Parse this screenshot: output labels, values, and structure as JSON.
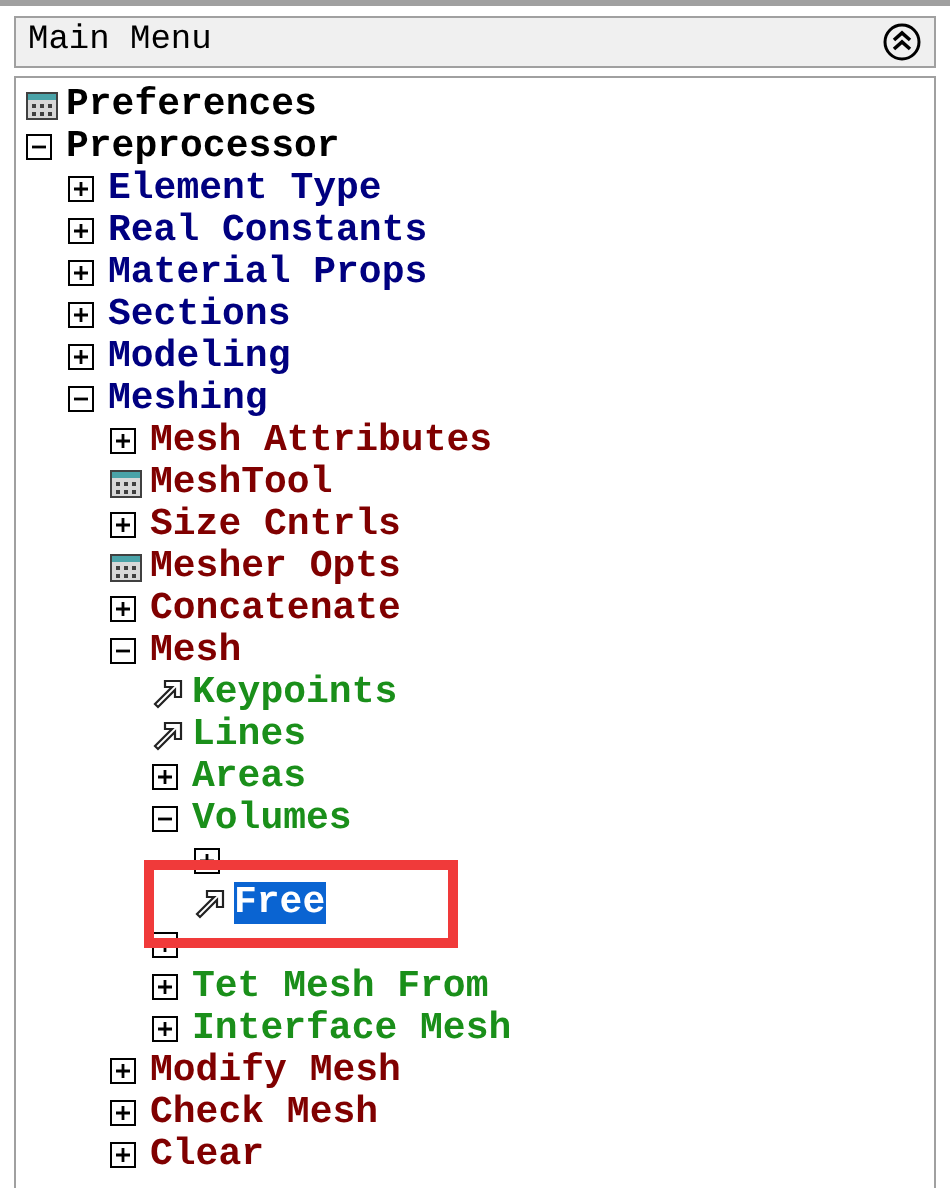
{
  "panel": {
    "title": "Main Menu"
  },
  "tree": [
    {
      "label": "Preferences",
      "kind": "dialog",
      "selected": false
    },
    {
      "label": "Preprocessor",
      "kind": "folder",
      "expanded": true,
      "selected": false,
      "children": [
        {
          "label": "Element Type",
          "kind": "folder",
          "expanded": false,
          "selected": false
        },
        {
          "label": "Real Constants",
          "kind": "folder",
          "expanded": false,
          "selected": false
        },
        {
          "label": "Material Props",
          "kind": "folder",
          "expanded": false,
          "selected": false
        },
        {
          "label": "Sections",
          "kind": "folder",
          "expanded": false,
          "selected": false
        },
        {
          "label": "Modeling",
          "kind": "folder",
          "expanded": false,
          "selected": false
        },
        {
          "label": "Meshing",
          "kind": "folder",
          "expanded": true,
          "selected": false,
          "children": [
            {
              "label": "Mesh Attributes",
              "kind": "folder",
              "expanded": false,
              "selected": false
            },
            {
              "label": "MeshTool",
              "kind": "dialog",
              "selected": false
            },
            {
              "label": "Size Cntrls",
              "kind": "folder",
              "expanded": false,
              "selected": false
            },
            {
              "label": "Mesher Opts",
              "kind": "dialog",
              "selected": false
            },
            {
              "label": "Concatenate",
              "kind": "folder",
              "expanded": false,
              "selected": false
            },
            {
              "label": "Mesh",
              "kind": "folder",
              "expanded": true,
              "selected": false,
              "children": [
                {
                  "label": "Keypoints",
                  "kind": "command",
                  "selected": false
                },
                {
                  "label": "Lines",
                  "kind": "command",
                  "selected": false
                },
                {
                  "label": "Areas",
                  "kind": "folder",
                  "expanded": false,
                  "selected": false
                },
                {
                  "label": "Volumes",
                  "kind": "folder",
                  "expanded": true,
                  "selected": false,
                  "children": [
                    {
                      "kind": "folder",
                      "expanded": false,
                      "selected": false,
                      "highlighted": false
                    },
                    {
                      "label": "Free",
                      "kind": "command",
                      "selected": true,
                      "highlighted": true
                    }
                  ]
                },
                {
                  "kind": "folder",
                  "expanded": false,
                  "selected": false
                },
                {
                  "label": "Tet Mesh From",
                  "kind": "folder",
                  "expanded": false,
                  "selected": false
                },
                {
                  "label": "Interface Mesh",
                  "kind": "folder",
                  "expanded": false,
                  "selected": false
                }
              ]
            },
            {
              "label": "Modify Mesh",
              "kind": "folder",
              "expanded": false,
              "selected": false
            },
            {
              "label": "Check Mesh",
              "kind": "folder",
              "expanded": false,
              "selected": false
            },
            {
              "label": "Clear",
              "kind": "folder",
              "expanded": false,
              "selected": false
            }
          ]
        }
      ]
    }
  ]
}
